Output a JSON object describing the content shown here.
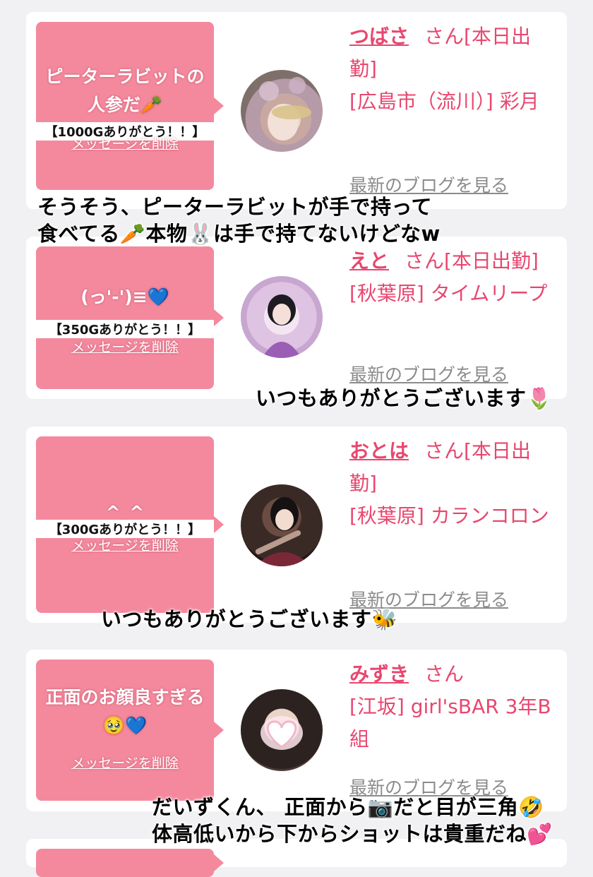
{
  "cards": [
    {
      "message": "ピーターラビットの人参だ🥕",
      "thanks": "【1000Gありがとう！！】",
      "delete_label": "メッセージを削除",
      "name": "つばさ",
      "suffix": "さん[本日出勤]",
      "location": "[広島市（流川）] 彩月",
      "blog_label": "最新のブログを見る"
    },
    {
      "message": "(っ'-')≡💙",
      "thanks": "【350Gありがとう！！】",
      "delete_label": "メッセージを削除",
      "name": "えと",
      "suffix": "さん[本日出勤]",
      "location": "[秋葉原] タイムリープ",
      "blog_label": "最新のブログを見る"
    },
    {
      "message": "^_^",
      "thanks": "【300Gありがとう！！】",
      "delete_label": "メッセージを削除",
      "name": "おとは",
      "suffix": "さん[本日出勤]",
      "location": "[秋葉原] カランコロン",
      "blog_label": "最新のブログを見る"
    },
    {
      "message": "正面のお顔良すぎる🥹💙",
      "thanks": "",
      "delete_label": "メッセージを削除",
      "name": "みずき",
      "suffix": "さん",
      "location": "[江坂] girl'sBAR 3年B組",
      "blog_label": "最新のブログを見る"
    }
  ],
  "overlays": {
    "o1_line1": "そうそう、ピーターラビットが手で持って",
    "o1_line2": "食べてる🥕本物🐰は手で持てないけどなw",
    "o2": "いつもありがとうございます🌷",
    "o3": "いつもありがとうございます🐝",
    "o4_line1": "だいずくん、 正面から📷だと目が三角🤣",
    "o4_line2": "体高低いから下からショットは貴重だね💕"
  },
  "colors": {
    "bubble": "#f4899d",
    "accent_text": "#e8476f",
    "blog_link": "#8b8b8b",
    "background": "#f1f1f3"
  }
}
